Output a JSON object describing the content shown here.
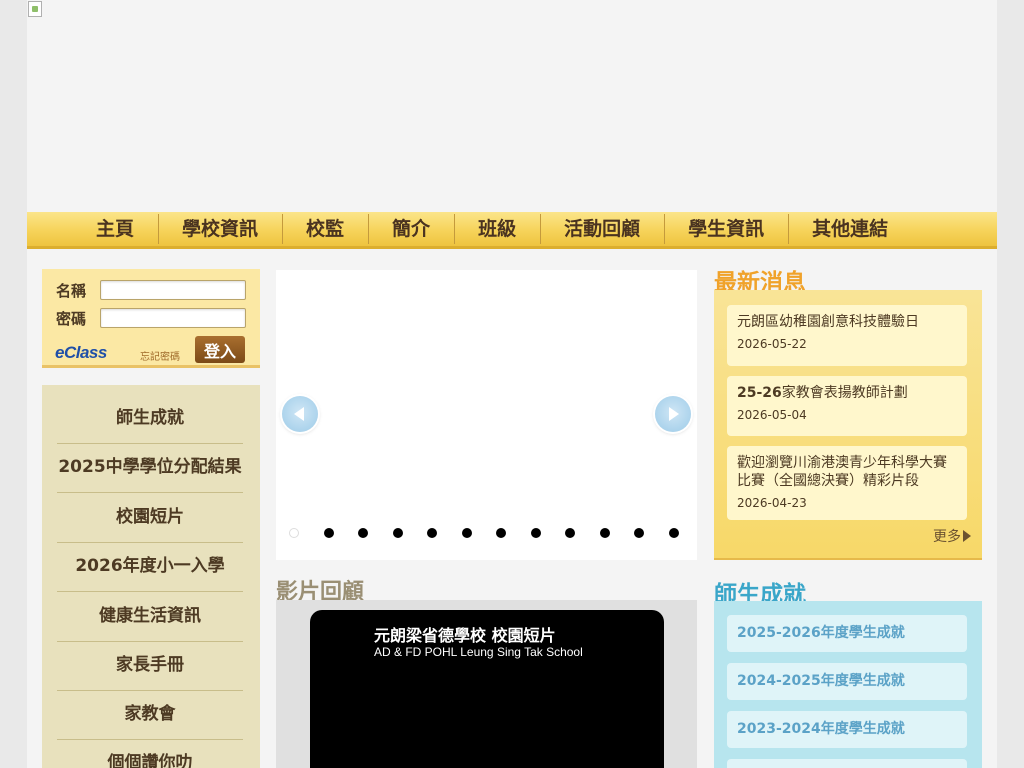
{
  "nav": [
    "主頁",
    "學校資訊",
    "校監",
    "簡介",
    "班級",
    "活動回顧",
    "學生資訊",
    "其他連結"
  ],
  "login": {
    "name_label": "名稱",
    "password_label": "密碼",
    "brand": "eClass",
    "forgot": "忘記密碼",
    "submit": "登入"
  },
  "side_menu": [
    "師生成就",
    "2025中學學位分配結果",
    "校園短片",
    "2026年度小一入學",
    "健康生活資訊",
    "家長手冊",
    "家教會",
    "個個讚你叻"
  ],
  "slider": {
    "slide_count": 12,
    "active_index": 0
  },
  "video": {
    "section_title": "影片回顧",
    "title_cn": "元朗梁省德學校 校園短片",
    "title_en": "AD & FD POHL Leung Sing Tak School"
  },
  "news": {
    "title": "最新消息",
    "items": [
      {
        "headline": "元朗區幼稚園創意科技體驗日",
        "date": "2026-05-22"
      },
      {
        "headline_bold": "25-26",
        "headline": "家教會表揚教師計劃",
        "date": "2026-05-04"
      },
      {
        "headline": "歡迎瀏覽川渝港澳青少年科學大賽比賽（全國總決賽）精彩片段",
        "date": "2026-04-23"
      }
    ],
    "more": "更多"
  },
  "achievements": {
    "title": "師生成就",
    "items": [
      "2025-2026年度學生成就",
      "2024-2025年度學生成就",
      "2023-2024年度學生成就"
    ]
  },
  "colors": {
    "nav": "#f6d35a",
    "news_accent": "#f0a22a",
    "achievement_accent": "#3aa6c9",
    "login_button": "#7c4a17"
  }
}
